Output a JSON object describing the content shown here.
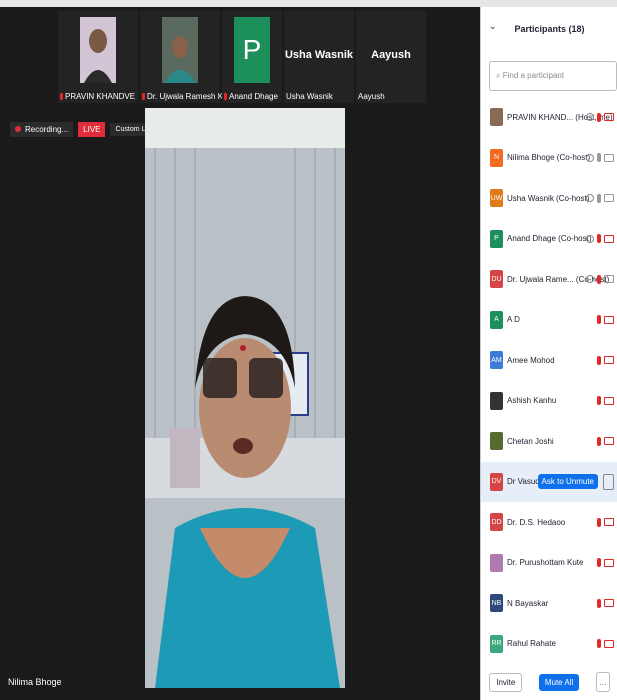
{
  "thumbnails": [
    {
      "name": "PRAVIN KHANDVE",
      "muted": true
    },
    {
      "name": "Dr. Ujwala Ramesh  K...",
      "muted": true
    },
    {
      "name": "Anand Dhage",
      "muted": true,
      "initial": "P"
    },
    {
      "name": "Usha Wasnik",
      "display": "Usha Wasnik"
    },
    {
      "name": "Aayush",
      "display": "Aayush"
    }
  ],
  "recording": {
    "label": "Recording..."
  },
  "live_label": "LIVE",
  "streaming_label": "Custom Live Streaming Service",
  "active_speaker": "Nilima Bhoge",
  "participants": {
    "title": "Participants (18)",
    "search_placeholder": "Find a participant",
    "rows": [
      {
        "name": "PRAVIN KHAND... (Host, me)",
        "avatar": "",
        "color": "#8a6a52"
      },
      {
        "name": "Nilima Bhoge (Co-host)",
        "avatar": "N",
        "color": "#f26b21"
      },
      {
        "name": "Usha Wasnik (Co-host)",
        "avatar": "UW",
        "color": "#e07b1a"
      },
      {
        "name": "Anand Dhage (Co-host)",
        "avatar": "P",
        "color": "#1c8f5b"
      },
      {
        "name": "Dr. Ujwala Rame... (Co-host)",
        "avatar": "DU",
        "color": "#d64545"
      },
      {
        "name": "A D",
        "avatar": "A",
        "color": "#1c8f5b"
      },
      {
        "name": "Amee Mohod",
        "avatar": "AM",
        "color": "#3c7bd6"
      },
      {
        "name": "Ashish Kanhu",
        "avatar": "",
        "color": "#333"
      },
      {
        "name": "Chetan Joshi",
        "avatar": "",
        "color": "#556b2f"
      },
      {
        "name": "Dr Vasudeo Pat",
        "avatar": "DV",
        "color": "#d64545"
      },
      {
        "name": "Dr. D.S. Hedaoo",
        "avatar": "DD",
        "color": "#d64545"
      },
      {
        "name": "Dr. Purushottam Kute",
        "avatar": "",
        "color": "#b07ab0"
      },
      {
        "name": "N Bayaskar",
        "avatar": "NB",
        "color": "#2e4a7a"
      },
      {
        "name": "Rahul Rahate",
        "avatar": "RR",
        "color": "#3aa87a"
      }
    ],
    "ask_to_unmute": "Ask to Unmute",
    "invite_label": "Invite",
    "mute_all_label": "Mute All"
  }
}
